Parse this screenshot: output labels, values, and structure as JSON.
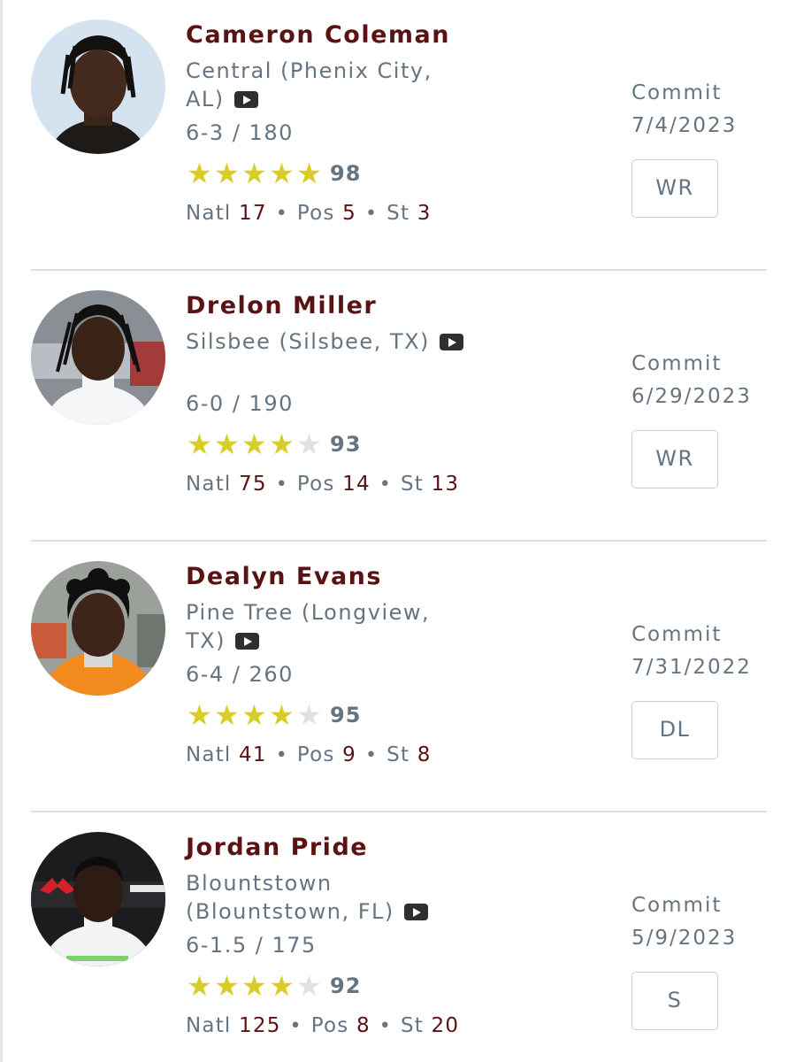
{
  "colors": {
    "name": "#5a1312",
    "meta": "#667482",
    "star_on": "#d8cd25",
    "star_off": "#e1e1e1",
    "divider": "#dedede"
  },
  "players": [
    {
      "name": "Cameron Coleman",
      "school": "Central (Phenix City, AL)",
      "video_icon": "video-play-icon",
      "measurables": "6-3 / 180",
      "stars": 5,
      "rating": "98",
      "natl_label": "Natl",
      "natl": "17",
      "pos_label": "Pos",
      "pos": "5",
      "st_label": "St",
      "st": "3",
      "commit_label": "Commit",
      "commit_date": "7/4/2023",
      "position": "WR"
    },
    {
      "name": "Drelon Miller",
      "school": "Silsbee (Silsbee, TX)",
      "video_icon": "video-play-icon",
      "measurables": "6-0 / 190",
      "stars": 4,
      "rating": "93",
      "natl_label": "Natl",
      "natl": "75",
      "pos_label": "Pos",
      "pos": "14",
      "st_label": "St",
      "st": "13",
      "commit_label": "Commit",
      "commit_date": "6/29/2023",
      "position": "WR"
    },
    {
      "name": "Dealyn Evans",
      "school": "Pine Tree (Longview, TX)",
      "video_icon": "video-play-icon",
      "measurables": "6-4 / 260",
      "stars": 4,
      "rating": "95",
      "natl_label": "Natl",
      "natl": "41",
      "pos_label": "Pos",
      "pos": "9",
      "st_label": "St",
      "st": "8",
      "commit_label": "Commit",
      "commit_date": "7/31/2022",
      "position": "DL"
    },
    {
      "name": "Jordan Pride",
      "school": "Blountstown (Blountstown, FL)",
      "video_icon": "video-play-icon",
      "measurables": "6-1.5 / 175",
      "stars": 4,
      "rating": "92",
      "natl_label": "Natl",
      "natl": "125",
      "pos_label": "Pos",
      "pos": "8",
      "st_label": "St",
      "st": "20",
      "commit_label": "Commit",
      "commit_date": "5/9/2023",
      "position": "S"
    }
  ]
}
